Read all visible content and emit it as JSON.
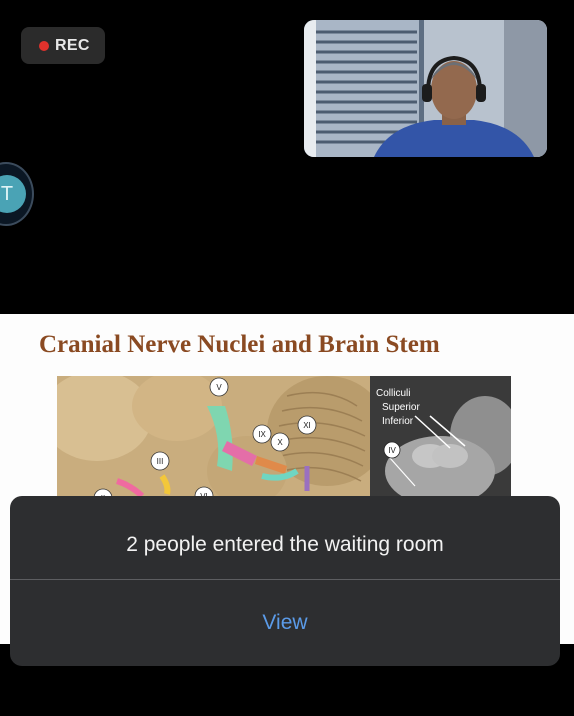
{
  "recording": {
    "label": "REC",
    "dot_color": "#e0322c"
  },
  "self_video": {
    "icon": "participant-video"
  },
  "side_avatar": {
    "initial": "T"
  },
  "slide": {
    "title": "Cranial Nerve Nuclei and Brain Stem",
    "title_color": "#8a4a22",
    "left_image_labels": [
      "V",
      "IX",
      "X",
      "XI",
      "III",
      "VI",
      "II"
    ],
    "right_image_labels": {
      "colliculi": "Colliculi",
      "superior": "Superior",
      "inferior": "Inferior",
      "nerve": "IV"
    }
  },
  "notification": {
    "message": "2 people entered the waiting room",
    "action_label": "View",
    "action_color": "#5b9be8"
  }
}
